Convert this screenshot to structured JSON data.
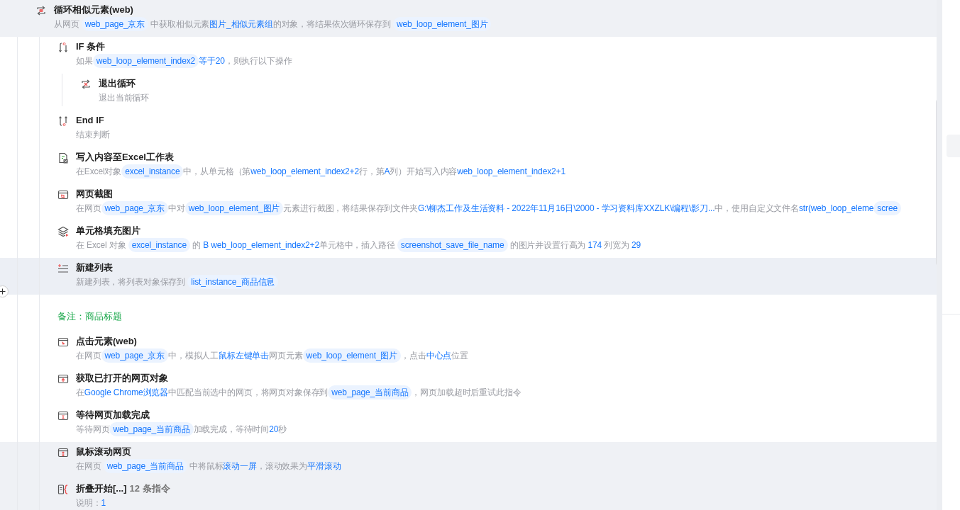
{
  "steps": [
    {
      "kind": "loop",
      "title": "循环相似元素(web)",
      "selected": true,
      "hovered": false,
      "desc": [
        {
          "kind": "text",
          "text": "从网页 "
        },
        {
          "kind": "var",
          "text": "web_page_京东"
        },
        {
          "kind": "text",
          "text": " 中获取相似元素"
        },
        {
          "kind": "value",
          "text": "图片_相似元素组"
        },
        {
          "kind": "text",
          "text": "的对象，将结果依次循环保存到 "
        },
        {
          "kind": "var",
          "text": "web_loop_element_图片"
        }
      ],
      "children": [
        {
          "kind": "if",
          "title": "IF 条件",
          "selected": false,
          "hovered": false,
          "desc": [
            {
              "kind": "text",
              "text": "如果"
            },
            {
              "kind": "var",
              "text": "web_loop_element_index2"
            },
            {
              "kind": "value",
              "text": "等于20"
            },
            {
              "kind": "text",
              "text": "，则执行以下操作"
            }
          ],
          "children": [
            {
              "kind": "exit",
              "title": "退出循环",
              "selected": false,
              "hovered": false,
              "desc": [
                {
                  "kind": "text",
                  "text": "退出当前循环"
                }
              ]
            }
          ]
        },
        {
          "kind": "endif",
          "title": "End IF",
          "selected": false,
          "hovered": false,
          "desc": [
            {
              "kind": "text",
              "text": "结束判断"
            }
          ]
        },
        {
          "kind": "excel",
          "title": "写入内容至Excel工作表",
          "selected": false,
          "hovered": false,
          "desc": [
            {
              "kind": "text",
              "text": "在Excel对象"
            },
            {
              "kind": "var",
              "text": "excel_instance"
            },
            {
              "kind": "text",
              "text": "中，从单元格（第"
            },
            {
              "kind": "value",
              "text": "web_loop_element_index2+2"
            },
            {
              "kind": "text",
              "text": "行，第"
            },
            {
              "kind": "value",
              "text": "A"
            },
            {
              "kind": "text",
              "text": "列）开始写入内容"
            },
            {
              "kind": "value",
              "text": "web_loop_element_index2+1"
            }
          ]
        },
        {
          "kind": "screenshot",
          "title": "网页截图",
          "selected": false,
          "hovered": false,
          "desc": [
            {
              "kind": "text",
              "text": "在网页"
            },
            {
              "kind": "var",
              "text": "web_page_京东"
            },
            {
              "kind": "text",
              "text": "中对"
            },
            {
              "kind": "var",
              "text": "web_loop_element_图片"
            },
            {
              "kind": "text",
              "text": "元素进行截图，将结果保存到文件夹"
            },
            {
              "kind": "value",
              "text": "G:\\柳杰工作及生活资料 - 2022年11月16日\\2000 - 学习资料库XXZLK\\编程\\影刀..."
            },
            {
              "kind": "text",
              "text": "中，使用自定义文件名"
            },
            {
              "kind": "value",
              "text": "str(web_loop_eleme"
            },
            {
              "kind": "var",
              "text": "scree"
            }
          ]
        },
        {
          "kind": "layers",
          "title": "单元格填充图片",
          "selected": false,
          "hovered": false,
          "desc": [
            {
              "kind": "text",
              "text": "在 Excel 对象 "
            },
            {
              "kind": "var",
              "text": "excel_instance"
            },
            {
              "kind": "text",
              "text": " 的 "
            },
            {
              "kind": "value",
              "text": "B web_loop_element_index2+2"
            },
            {
              "kind": "text",
              "text": "单元格中，插入路径 "
            },
            {
              "kind": "var",
              "text": "screenshot_save_file_name"
            },
            {
              "kind": "text",
              "text": " 的图片并设置行高为 "
            },
            {
              "kind": "value",
              "text": "174"
            },
            {
              "kind": "text",
              "text": " 列宽为 "
            },
            {
              "kind": "value",
              "text": "29"
            }
          ]
        },
        {
          "kind": "list",
          "title": "新建列表",
          "selected": false,
          "hovered": true,
          "desc": [
            {
              "kind": "text",
              "text": "新建列表，将列表对象保存到 "
            },
            {
              "kind": "var",
              "text": "list_instance_商品信息"
            }
          ]
        },
        {
          "kind": "note",
          "text": "备注：商品标题",
          "selected": false,
          "hovered": false
        },
        {
          "kind": "click",
          "title": "点击元素(web)",
          "selected": false,
          "hovered": false,
          "desc": [
            {
              "kind": "text",
              "text": "在网页"
            },
            {
              "kind": "var",
              "text": "web_page_京东"
            },
            {
              "kind": "text",
              "text": "中，模拟人工"
            },
            {
              "kind": "value",
              "text": "鼠标左键单击"
            },
            {
              "kind": "text",
              "text": "网页元素"
            },
            {
              "kind": "var",
              "text": "web_loop_element_图片"
            },
            {
              "kind": "text",
              "text": "，点击"
            },
            {
              "kind": "value",
              "text": "中心点"
            },
            {
              "kind": "text",
              "text": "位置"
            }
          ]
        },
        {
          "kind": "getpage",
          "title": "获取已打开的网页对象",
          "selected": false,
          "hovered": false,
          "desc": [
            {
              "kind": "text",
              "text": "在"
            },
            {
              "kind": "value",
              "text": "Google Chrome浏览器"
            },
            {
              "kind": "text",
              "text": "中匹配当前选中的网页，将网页对象保存到"
            },
            {
              "kind": "var",
              "text": "web_page_当前商品"
            },
            {
              "kind": "text",
              "text": "，网页加载超时后重试此指令"
            }
          ]
        },
        {
          "kind": "wait",
          "title": "等待网页加载完成",
          "selected": false,
          "hovered": false,
          "desc": [
            {
              "kind": "text",
              "text": "等待网页"
            },
            {
              "kind": "var",
              "text": "web_page_当前商品"
            },
            {
              "kind": "text",
              "text": "加载完成，等待时间"
            },
            {
              "kind": "value",
              "text": "20"
            },
            {
              "kind": "text",
              "text": "秒"
            }
          ]
        },
        {
          "kind": "scroll",
          "title": "鼠标滚动网页",
          "selected": true,
          "hovered": false,
          "desc": [
            {
              "kind": "text",
              "text": "在网页 "
            },
            {
              "kind": "var",
              "text": "web_page_当前商品"
            },
            {
              "kind": "text",
              "text": " 中将鼠标"
            },
            {
              "kind": "value",
              "text": "滚动一屏"
            },
            {
              "kind": "text",
              "text": "，滚动效果为"
            },
            {
              "kind": "value",
              "text": "平滑滚动"
            }
          ]
        },
        {
          "kind": "fold",
          "title": "折叠开始[...]",
          "count": "12 条指令",
          "selected": true,
          "hovered": false,
          "desc": [
            {
              "kind": "text",
              "text": "说明："
            },
            {
              "kind": "value",
              "text": "1"
            }
          ]
        }
      ]
    }
  ]
}
